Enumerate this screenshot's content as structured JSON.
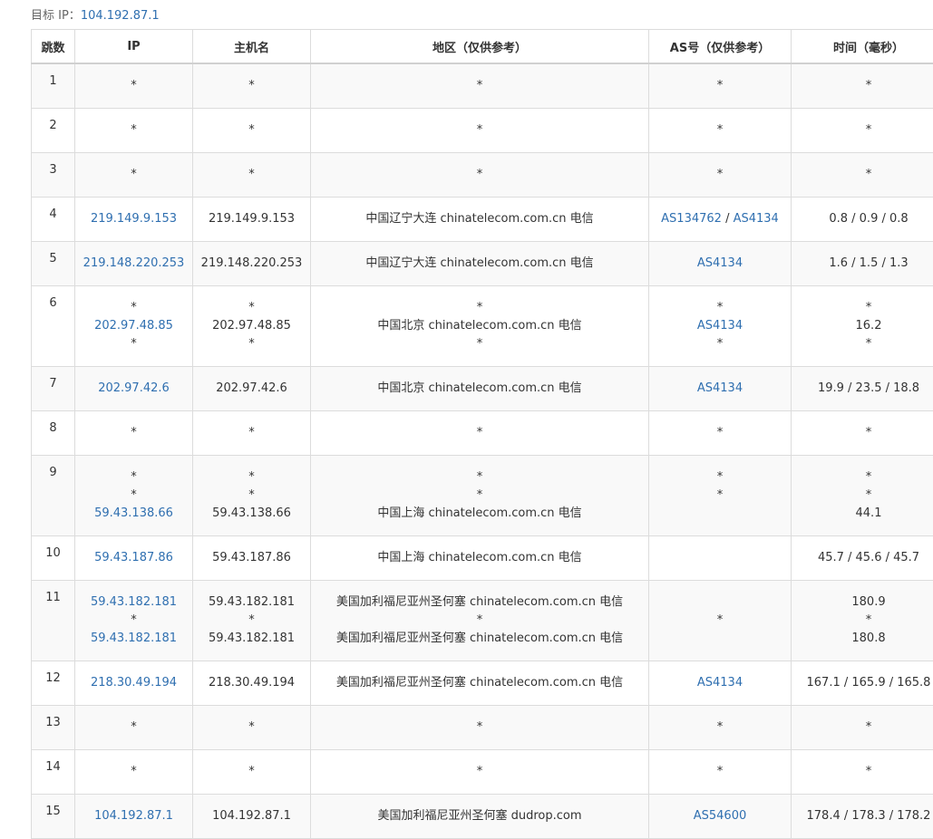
{
  "target": {
    "label": "目标 IP：",
    "ip": "104.192.87.1"
  },
  "columns": {
    "hop": "跳数",
    "ip": "IP",
    "host": "主机名",
    "region": "地区（仅供参考）",
    "as": "AS号（仅供参考）",
    "time": "时间（毫秒）"
  },
  "rows": [
    {
      "hop": "1",
      "ip": [
        "*"
      ],
      "host": [
        "*"
      ],
      "region": [
        "*"
      ],
      "as": [
        [
          {
            "t": "*"
          }
        ]
      ],
      "time": [
        "*"
      ]
    },
    {
      "hop": "2",
      "ip": [
        "*"
      ],
      "host": [
        "*"
      ],
      "region": [
        "*"
      ],
      "as": [
        [
          {
            "t": "*"
          }
        ]
      ],
      "time": [
        "*"
      ]
    },
    {
      "hop": "3",
      "ip": [
        "*"
      ],
      "host": [
        "*"
      ],
      "region": [
        "*"
      ],
      "as": [
        [
          {
            "t": "*"
          }
        ]
      ],
      "time": [
        "*"
      ]
    },
    {
      "hop": "4",
      "ip": [
        "219.149.9.153"
      ],
      "host": [
        "219.149.9.153"
      ],
      "region": [
        "中国辽宁大连 chinatelecom.com.cn 电信"
      ],
      "as": [
        [
          {
            "t": "AS134762",
            "link": true
          },
          {
            "t": " / "
          },
          {
            "t": "AS4134",
            "link": true
          }
        ]
      ],
      "time": [
        "0.8 / 0.9 / 0.8"
      ]
    },
    {
      "hop": "5",
      "ip": [
        "219.148.220.253"
      ],
      "host": [
        "219.148.220.253"
      ],
      "region": [
        "中国辽宁大连 chinatelecom.com.cn 电信"
      ],
      "as": [
        [
          {
            "t": "AS4134",
            "link": true
          }
        ]
      ],
      "time": [
        "1.6 / 1.5 / 1.3"
      ]
    },
    {
      "hop": "6",
      "ip": [
        "*",
        "202.97.48.85",
        "*"
      ],
      "host": [
        "*",
        "202.97.48.85",
        "*"
      ],
      "region": [
        "*",
        "中国北京 chinatelecom.com.cn 电信",
        "*"
      ],
      "as": [
        [
          {
            "t": "*"
          }
        ],
        [
          {
            "t": "AS4134",
            "link": true
          }
        ],
        [
          {
            "t": "*"
          }
        ]
      ],
      "time": [
        "*",
        "16.2",
        "*"
      ]
    },
    {
      "hop": "7",
      "ip": [
        "202.97.42.6"
      ],
      "host": [
        "202.97.42.6"
      ],
      "region": [
        "中国北京 chinatelecom.com.cn 电信"
      ],
      "as": [
        [
          {
            "t": "AS4134",
            "link": true
          }
        ]
      ],
      "time": [
        "19.9 / 23.5 / 18.8"
      ]
    },
    {
      "hop": "8",
      "ip": [
        "*"
      ],
      "host": [
        "*"
      ],
      "region": [
        "*"
      ],
      "as": [
        [
          {
            "t": "*"
          }
        ]
      ],
      "time": [
        "*"
      ]
    },
    {
      "hop": "9",
      "ip": [
        "*",
        "*",
        "59.43.138.66"
      ],
      "host": [
        "*",
        "*",
        "59.43.138.66"
      ],
      "region": [
        "*",
        "*",
        "中国上海 chinatelecom.com.cn 电信"
      ],
      "as": [
        [
          {
            "t": "*"
          }
        ],
        [
          {
            "t": "*"
          }
        ],
        [
          {
            "t": ""
          }
        ]
      ],
      "time": [
        "*",
        "*",
        "44.1"
      ]
    },
    {
      "hop": "10",
      "ip": [
        "59.43.187.86"
      ],
      "host": [
        "59.43.187.86"
      ],
      "region": [
        "中国上海 chinatelecom.com.cn 电信"
      ],
      "as": [
        [
          {
            "t": ""
          }
        ]
      ],
      "time": [
        "45.7 / 45.6 / 45.7"
      ]
    },
    {
      "hop": "11",
      "ip": [
        "59.43.182.181",
        "*",
        "59.43.182.181"
      ],
      "host": [
        "59.43.182.181",
        "*",
        "59.43.182.181"
      ],
      "region": [
        "美国加利福尼亚州圣何塞 chinatelecom.com.cn 电信",
        "*",
        "美国加利福尼亚州圣何塞 chinatelecom.com.cn 电信"
      ],
      "as": [
        [
          {
            "t": ""
          }
        ],
        [
          {
            "t": "*"
          }
        ],
        [
          {
            "t": ""
          }
        ]
      ],
      "time": [
        "180.9",
        "*",
        "180.8"
      ]
    },
    {
      "hop": "12",
      "ip": [
        "218.30.49.194"
      ],
      "host": [
        "218.30.49.194"
      ],
      "region": [
        "美国加利福尼亚州圣何塞 chinatelecom.com.cn 电信"
      ],
      "as": [
        [
          {
            "t": "AS4134",
            "link": true
          }
        ]
      ],
      "time": [
        "167.1 / 165.9 / 165.8"
      ]
    },
    {
      "hop": "13",
      "ip": [
        "*"
      ],
      "host": [
        "*"
      ],
      "region": [
        "*"
      ],
      "as": [
        [
          {
            "t": "*"
          }
        ]
      ],
      "time": [
        "*"
      ]
    },
    {
      "hop": "14",
      "ip": [
        "*"
      ],
      "host": [
        "*"
      ],
      "region": [
        "*"
      ],
      "as": [
        [
          {
            "t": "*"
          }
        ]
      ],
      "time": [
        "*"
      ]
    },
    {
      "hop": "15",
      "ip": [
        "104.192.87.1"
      ],
      "host": [
        "104.192.87.1"
      ],
      "region": [
        "美国加利福尼亚州圣何塞 dudrop.com"
      ],
      "as": [
        [
          {
            "t": "AS54600",
            "link": true
          }
        ]
      ],
      "time": [
        "178.4 / 178.3 / 178.2"
      ]
    }
  ]
}
